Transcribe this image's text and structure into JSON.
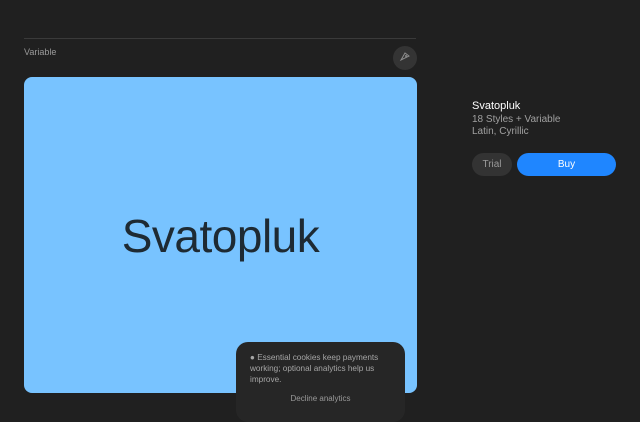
{
  "header": {
    "variable_label": "Variable",
    "tool_icon": "pen-nib-icon"
  },
  "preview": {
    "sample_text": "Svatopluk",
    "background_color": "#78c3ff"
  },
  "cookie_banner": {
    "message": "● Essential cookies keep payments working; optional analytics help us improve.",
    "decline_label": "Decline analytics"
  },
  "font_info": {
    "name": "Svatopluk",
    "styles": "18 Styles + Variable",
    "scripts": "Latin, Cyrillic"
  },
  "actions": {
    "trial_label": "Trial",
    "buy_label": "Buy",
    "buy_color": "#1f86ff"
  }
}
